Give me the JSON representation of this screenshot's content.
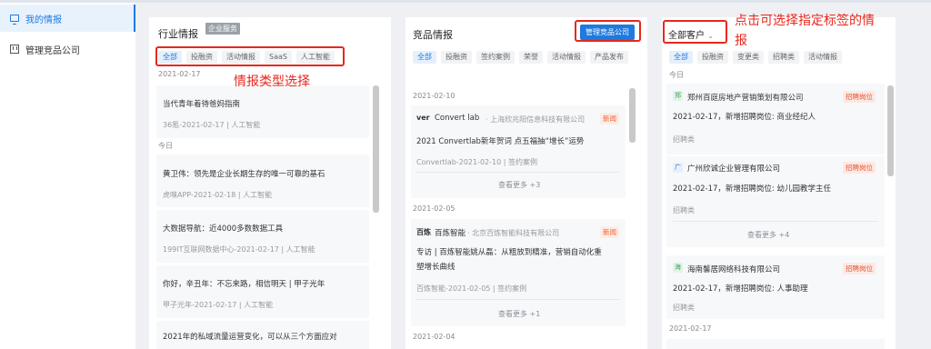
{
  "sidebar": {
    "items": [
      {
        "label": "我的情报",
        "icon": "monitor-icon",
        "active": true
      },
      {
        "label": "管理竞品公司",
        "icon": "grid-icon",
        "active": false
      }
    ]
  },
  "industry": {
    "title": "行业情报",
    "service_tag": "企业服务",
    "tabs": [
      "全部",
      "投融资",
      "活动情报",
      "SaaS",
      "人工智能"
    ],
    "date1": "2021-02-17",
    "today": "今日",
    "items": [
      {
        "title": "当代青年着待爸妈指南",
        "meta": "36氪-2021-02-17 | 人工智能"
      },
      {
        "title": "黄卫伟：领先是企业长期生存的唯一可靠的基石",
        "meta": "虎嗅APP-2021-02-18 | 人工智能"
      },
      {
        "title": "大数据导航：近4000多数数据工具",
        "meta": "199IT互联网数据中心-2021-02-17 | 人工智能"
      },
      {
        "title": "你好，辛丑年：不忘来路，相信明天 | 甲子光年",
        "meta": "甲子光年-2021-02-17 | 人工智能"
      },
      {
        "title": "2021年的私域流量运营变化，可以从三个方面应对",
        "meta": ""
      }
    ]
  },
  "competitor": {
    "title": "竞品情报",
    "manage_button": "管理竞品公司",
    "tabs": [
      "全部",
      "投融资",
      "签约案例",
      "荣誉",
      "活动情报",
      "产品发布"
    ],
    "groups": [
      {
        "date": "2021-02-10",
        "logo": "ver",
        "company": "Convert lab",
        "company_full": "· 上海欣兆阳信息科技有限公司",
        "badge": "新闻",
        "text": "2021 Convertlab新年贺词 点五福抽“增长”运势",
        "meta": "Convertlab-2021-02-10 | 签约案例",
        "more": "查看更多 +3"
      },
      {
        "date": "2021-02-05",
        "logo": "百炼",
        "company": "百炼智能",
        "company_full": "· 北京百炼智能科技有限公司",
        "badge": "新闻",
        "text": "专访 | 百炼智能姚从磊：从粗放到精准，营销自动化重塑增长曲线",
        "meta": "百炼智能-2021-02-05 | 签约案例",
        "more": "查看更多 +1"
      }
    ],
    "date3": "2021-02-04"
  },
  "customers": {
    "dropdown": "全部客户",
    "tabs": [
      "全部",
      "投融资",
      "变更类",
      "招聘类",
      "活动情报"
    ],
    "today": "今日",
    "items": [
      {
        "logo": "郑",
        "company": "郑州百庭房地产营销策划有限公司",
        "badge": "招聘岗位",
        "text": "2021-02-17，新增招聘岗位: 商业经纪人",
        "cat": "招聘类"
      },
      {
        "logo": "广",
        "company": "广州欣诚企业管理有限公司",
        "badge": "招聘岗位",
        "text": "2021-02-17，新增招聘岗位: 幼儿园教学主任",
        "cat": "招聘类",
        "more": "查看更多 +4"
      },
      {
        "logo": "海",
        "company": "海南馨居网络科技有限公司",
        "badge": "招聘岗位",
        "text": "2021-02-17，新增招聘岗位: 人事助理",
        "cat": "招聘类"
      }
    ],
    "date2": "2021-02-17"
  },
  "annotations": {
    "type_select": "情报类型选择",
    "tag_select_line1": "点击可选择指定标签的情",
    "tag_select_line2": "报"
  },
  "colors": {
    "accent": "#1f7ae0",
    "annotation": "#e8271d",
    "news": "#f0612e"
  }
}
